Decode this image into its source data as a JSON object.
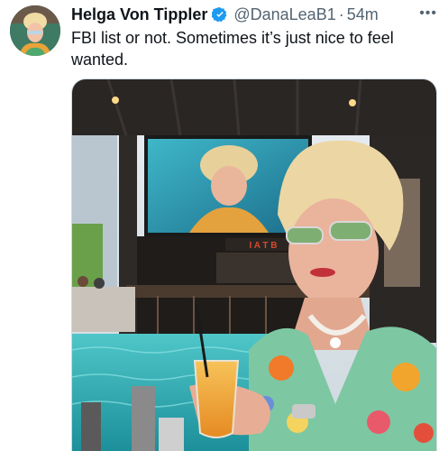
{
  "tweet": {
    "display_name": "Helga Von Tippler",
    "handle": "@DanaLeaB1",
    "separator": "·",
    "time": "54m",
    "more_label": "•••",
    "text": "FBI list or not. Sometimes it’s just nice to feel wanted.",
    "verified_icon": "verified-badge-icon",
    "colors": {
      "verified": "#1d9bf0",
      "secondary_text": "#536471"
    }
  },
  "media": {
    "screen_sign": "I A T B"
  }
}
